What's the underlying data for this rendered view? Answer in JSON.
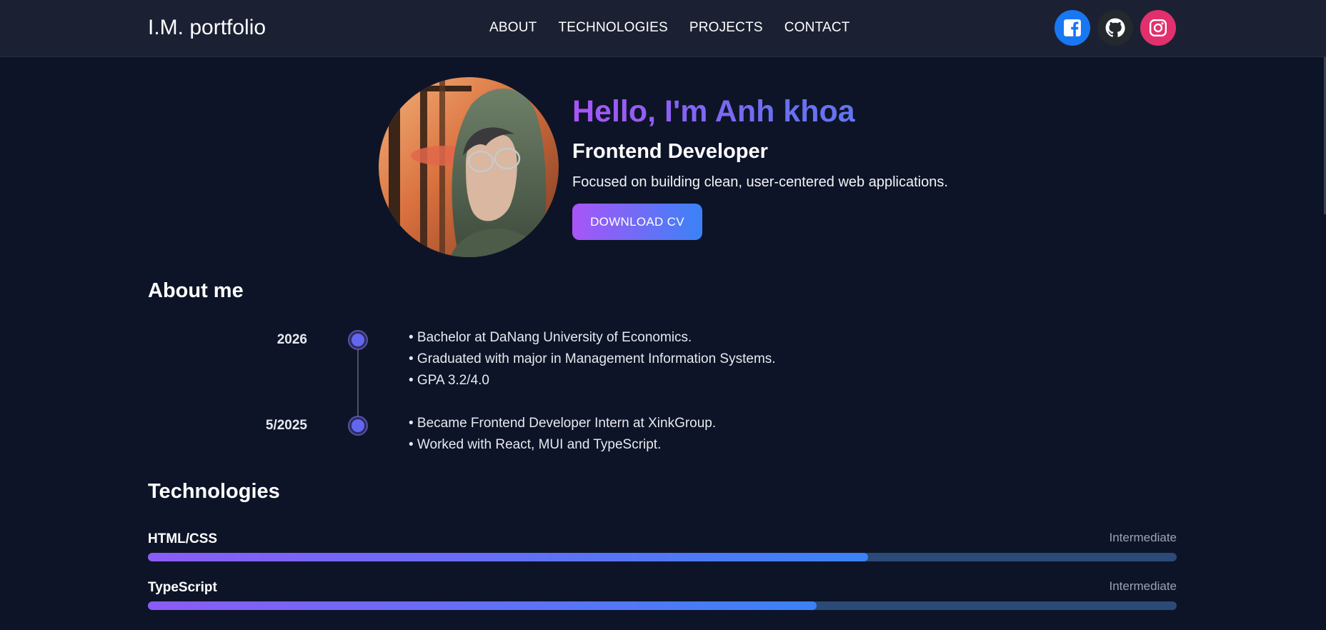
{
  "header": {
    "brand": "I.M. portfolio",
    "nav": [
      {
        "label": "ABOUT"
      },
      {
        "label": "TECHNOLOGIES"
      },
      {
        "label": "PROJECTS"
      },
      {
        "label": "CONTACT"
      }
    ],
    "socials": [
      {
        "name": "facebook",
        "icon": "facebook-icon",
        "color": "#1877f2"
      },
      {
        "name": "github",
        "icon": "github-icon",
        "color": "#24292e"
      },
      {
        "name": "instagram",
        "icon": "instagram-icon",
        "color": "#e1306c"
      }
    ]
  },
  "hero": {
    "greeting": "Hello, I'm Anh khoa",
    "role": "Frontend Developer",
    "tagline": "Focused on building clean, user-centered web applications.",
    "cv_button": "DOWNLOAD CV"
  },
  "about": {
    "title": "About me",
    "timeline": [
      {
        "year": "2026",
        "lines": [
          "• Bachelor at DaNang University of Economics.",
          "• Graduated with major in Management Information Systems.",
          "• GPA 3.2/4.0"
        ]
      },
      {
        "year": "5/2025",
        "lines": [
          "• Became Frontend Developer Intern at XinkGroup.",
          "• Worked with React, MUI and TypeScript."
        ]
      }
    ]
  },
  "technologies": {
    "title": "Technologies",
    "skills": [
      {
        "name": "HTML/CSS",
        "level": "Intermediate",
        "progress": 0.7
      },
      {
        "name": "TypeScript",
        "level": "Intermediate",
        "progress": 0.65
      }
    ]
  },
  "colors": {
    "background": "#0d1427",
    "header": "#1b2133",
    "accent_purple": "#a855f7",
    "accent_blue": "#3b82f6",
    "bar_track": "#2b4a78"
  }
}
